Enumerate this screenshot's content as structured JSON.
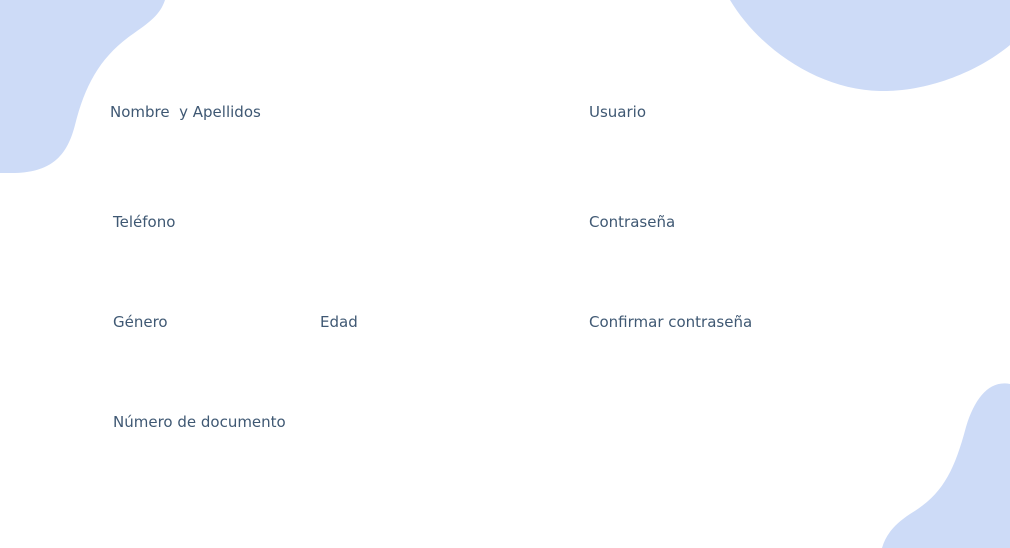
{
  "theme": {
    "label_color": "#3f5873",
    "blob_color": "#cddbf7",
    "background": "#ffffff"
  },
  "form": {
    "labels": {
      "full_name": "Nombre  y Apellidos",
      "username": "Usuario",
      "phone": "Teléfono",
      "password": "Contraseña",
      "gender": "Género",
      "age": "Edad",
      "confirm_password": "Confirmar contraseña",
      "document_number": "Número de documento"
    }
  }
}
